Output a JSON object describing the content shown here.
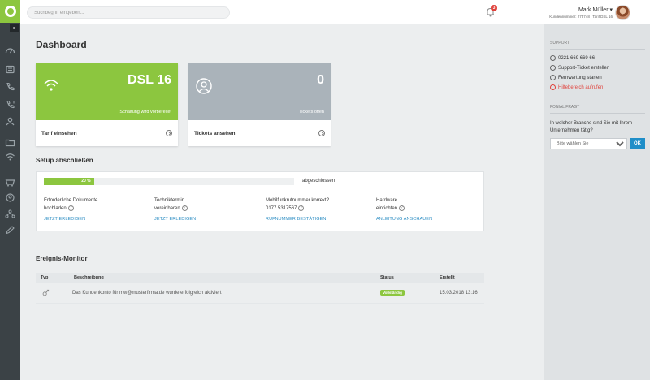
{
  "colors": {
    "brand": "#8cc63f",
    "sidebar": "#3b4246",
    "link": "#2f8fc4",
    "alert": "#e0403a",
    "ok_button": "#1f8ec8"
  },
  "sidebar": {
    "icons": [
      "dashboard-icon",
      "gauge-icon",
      "phone-list-icon",
      "phone-icon",
      "document-icon",
      "users-icon",
      "folder-icon",
      "wifi-icon",
      "shop-icon",
      "user-circle-icon",
      "network-icon",
      "pen-icon"
    ]
  },
  "header": {
    "search_placeholder": "Suchbegriff eingeben...",
    "notification_count": "3",
    "user_name": "Mark Müller",
    "user_sub": "Kundennummer: 275748 | Tarif DSL 16"
  },
  "main": {
    "title": "Dashboard",
    "cards": [
      {
        "value": "DSL 16",
        "sub": "Schaltung wird vorbereitet",
        "link": "Tarif einsehen",
        "icon": "wifi-icon"
      },
      {
        "value": "0",
        "sub": "Tickets offen",
        "link": "Tickets ansehen",
        "icon": "user-circle-icon"
      }
    ],
    "setup": {
      "title": "Setup abschließen",
      "progress": 20,
      "progress_label": "20 %",
      "progress_text": "abgeschlossen",
      "tasks": [
        {
          "line1": "Erforderliche Dokumente",
          "line2": "hochladen",
          "link": "JETZT ERLEDIGEN"
        },
        {
          "line1": "Techniktermin",
          "line2": "vereinbaren",
          "link": "JETZT ERLEDIGEN"
        },
        {
          "line1": "Mobilfunkrufnummer korrekt?",
          "line2": "0177 5317567",
          "link": "RUFNUMMER BESTÄTIGEN"
        },
        {
          "line1": "Hardware",
          "line2": "einrichten",
          "link": "ANLEITUNG ANSCHAUEN"
        }
      ]
    },
    "monitor": {
      "title": "Ereignis-Monitor",
      "columns": [
        "Typ",
        "Beschreibung",
        "Status",
        "Erstellt"
      ],
      "rows": [
        {
          "icon": "link-icon",
          "description": "Das Kundenkonto für mw@musterfirma.de wurde erfolgreich aktiviert",
          "status": "Vollständig",
          "created": "15.03.2018 13:16"
        }
      ]
    }
  },
  "right": {
    "support_title": "SUPPORT",
    "phone": "0221 669 669 66",
    "support_ticket": "Support-Ticket erstellen",
    "remote": "Fernwartung starten",
    "help": "Hilfebereich aufrufen",
    "question_title": "FONIAL FRAGT",
    "question": "In welcher Branche sind Sie mit Ihrem Unternehmen tätig?",
    "select_placeholder": "Bitte wählen Sie",
    "ok_label": "OK"
  }
}
